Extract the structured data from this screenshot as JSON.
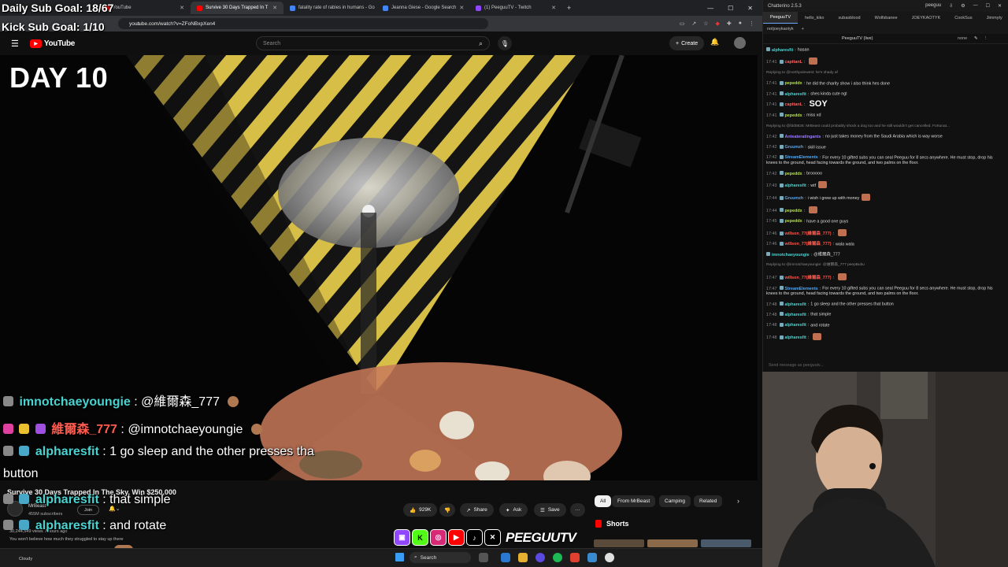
{
  "overlay": {
    "daily_goal": "Daily Sub Goal: 18/67",
    "kick_goal": "Kick Sub Goal: 1/10",
    "brand": "PEEGUUTV"
  },
  "browser": {
    "tabs": [
      {
        "label": "YouTube",
        "color": "#ff0000",
        "active": false
      },
      {
        "label": "Survive 30 Days Trapped In T",
        "color": "#ff0000",
        "active": true
      },
      {
        "label": "fatality rate of rabies in humans - Go",
        "color": "#4285f4",
        "active": false
      },
      {
        "label": "Jeanna Giese - Google Search",
        "color": "#4285f4",
        "active": false
      },
      {
        "label": "(1) PeeguuTV - Twitch",
        "color": "#9146ff",
        "active": false
      }
    ],
    "new_tab": "+",
    "url": "youtube.com/watch?v=ZFoNBxpXen4"
  },
  "youtube": {
    "logo": "YouTube",
    "search_placeholder": "Search",
    "create_label": "Create",
    "day_label": "DAY 10",
    "video_title": "Survive 30 Days Trapped In The Sky, Win $250,000",
    "channel_name": "MrBeast",
    "subscribers": "455M subscribers",
    "join_label": "Join",
    "likes": "929K",
    "share_label": "Share",
    "ask_label": "Ask",
    "save_label": "Save",
    "more_label": "···",
    "chips": [
      "All",
      "From MrBeast",
      "Camping",
      "Related"
    ],
    "shorts_label": "Shorts",
    "desc_views": "30,244,549 views 7 hours ago",
    "desc_text": "You won't believe how much they struggled to stay up there"
  },
  "stream_chat": [
    {
      "user": "imnotchaeyoungie",
      "color": "cyan",
      "text": ": @維爾森_777"
    },
    {
      "user": "維爾森_777",
      "color": "red",
      "text": ": @imnotchaeyoungie"
    },
    {
      "user": "alpharesfit",
      "color": "cyan",
      "text": ": 1 go sleep and the other presses tha"
    },
    {
      "user": "",
      "color": "cyan",
      "text": "button"
    },
    {
      "user": "alpharesfit",
      "color": "cyan",
      "text": ": that simple"
    },
    {
      "user": "alpharesfit",
      "color": "cyan",
      "text": ": and rotate"
    },
    {
      "user": "alpharesfit",
      "color": "cyan",
      "text": ":"
    }
  ],
  "taskbar": {
    "search_label": "Search",
    "weather": "Cloudy"
  },
  "chatterino": {
    "title": "Chatterino 2.5.3",
    "account": "peeguu",
    "tabs": [
      "PeeguuTV",
      "hello_kiko",
      "subasblood",
      "Wolfsbanee",
      "JOEYKAOTYK",
      "CookSus",
      "Jimmyty"
    ],
    "tabs2": [
      "notjoeykaotyk",
      "+"
    ],
    "channel_header": "PeeguuTV (live)",
    "mode": "none",
    "input_placeholder": "Send message as peeguutv...",
    "messages": [
      {
        "time": "",
        "user": "alpharesfit",
        "color": "#49d3d1",
        "text": "hasan",
        "reply": ""
      },
      {
        "time": "17:41",
        "user": "capttanL",
        "color": "#ff6060",
        "text": "",
        "reply": ""
      },
      {
        "time": "",
        "user": "",
        "color": "#888",
        "text": "",
        "reply": "Replying to @northpolewest: he's shady af"
      },
      {
        "time": "17:41",
        "user": "pepeddx",
        "color": "#b0e040",
        "text": "he did the charity show i also think hes done",
        "reply": ""
      },
      {
        "time": "17:41",
        "user": "alpharesfit",
        "color": "#49d3d1",
        "text": "shes kinda cute ngl",
        "reply": ""
      },
      {
        "time": "17:41",
        "user": "capttanL",
        "color": "#ff6060",
        "text": "SOY",
        "reply": ""
      },
      {
        "time": "17:41",
        "user": "pepeddx",
        "color": "#b0e040",
        "text": "miss xd",
        "reply": ""
      },
      {
        "time": "",
        "user": "",
        "color": "#888",
        "text": "",
        "reply": "Replying to @fdd0826: MrBeast could probably shock a dog too and he still wouldn't get cancelled. Fortunat..."
      },
      {
        "time": "17:42",
        "user": "Anteateratingants",
        "color": "#9b7bff",
        "text": "no just takes money from the Saudi Arabia  which is way worse",
        "reply": ""
      },
      {
        "time": "17:42",
        "user": "Gruumzh",
        "color": "#49a8ff",
        "text": "skill issue",
        "reply": ""
      },
      {
        "time": "17:42",
        "user": "StreamElements",
        "color": "#49a8ff",
        "text": "For every 10 gifted subs you can seal Peeguu for 8 secs anywhere. He must stop, drop his knees to the ground, head facing towards the ground, and two palms on the floor.",
        "reply": ""
      },
      {
        "time": "17:42",
        "user": "pepeddx",
        "color": "#b0e040",
        "text": "brooooo",
        "reply": ""
      },
      {
        "time": "17:43",
        "user": "alpharesfit",
        "color": "#49d3d1",
        "text": "wtf",
        "reply": ""
      },
      {
        "time": "17:44",
        "user": "Gruumzh",
        "color": "#49a8ff",
        "text": "i wish i grew up with money",
        "reply": ""
      },
      {
        "time": "17:44",
        "user": "pepeddx",
        "color": "#b0e040",
        "text": "",
        "reply": ""
      },
      {
        "time": "17:45",
        "user": "pepeddx",
        "color": "#b0e040",
        "text": "have a good one guys",
        "reply": ""
      },
      {
        "time": "17:46",
        "user": "willson_77(維爾森_777)",
        "color": "#ff5b4f",
        "text": "",
        "reply": ""
      },
      {
        "time": "17:46",
        "user": "willson_77(維爾森_777)",
        "color": "#ff5b4f",
        "text": "wala wala",
        "reply": ""
      },
      {
        "time": "",
        "user": "imnotchaeyoungie",
        "color": "#49d3d1",
        "text": "@維爾森_777",
        "reply": ""
      },
      {
        "time": "",
        "user": "",
        "color": "#888",
        "text": "",
        "reply": "Replying to @imnotchaeyoungie: @維爾森_777 peepBubu"
      },
      {
        "time": "17:47",
        "user": "willson_77(維爾森_777)",
        "color": "#ff5b4f",
        "text": "",
        "reply": ""
      },
      {
        "time": "17:47",
        "user": "StreamElements",
        "color": "#49a8ff",
        "text": "For every 10 gifted subs you can seal Peeguu for 8 secs anywhere. He must stop, drop his knees to the ground, head facing towards the ground, and two palms on the floor.",
        "reply": ""
      },
      {
        "time": "17:48",
        "user": "alpharesfit",
        "color": "#49d3d1",
        "text": "1 go sleep and the other presses that button",
        "reply": ""
      },
      {
        "time": "17:48",
        "user": "alpharesfit",
        "color": "#49d3d1",
        "text": "that simple",
        "reply": ""
      },
      {
        "time": "17:48",
        "user": "alpharesfit",
        "color": "#49d3d1",
        "text": "and rotate",
        "reply": ""
      },
      {
        "time": "17:48",
        "user": "alpharesfit",
        "color": "#49d3d1",
        "text": "",
        "reply": ""
      }
    ]
  }
}
